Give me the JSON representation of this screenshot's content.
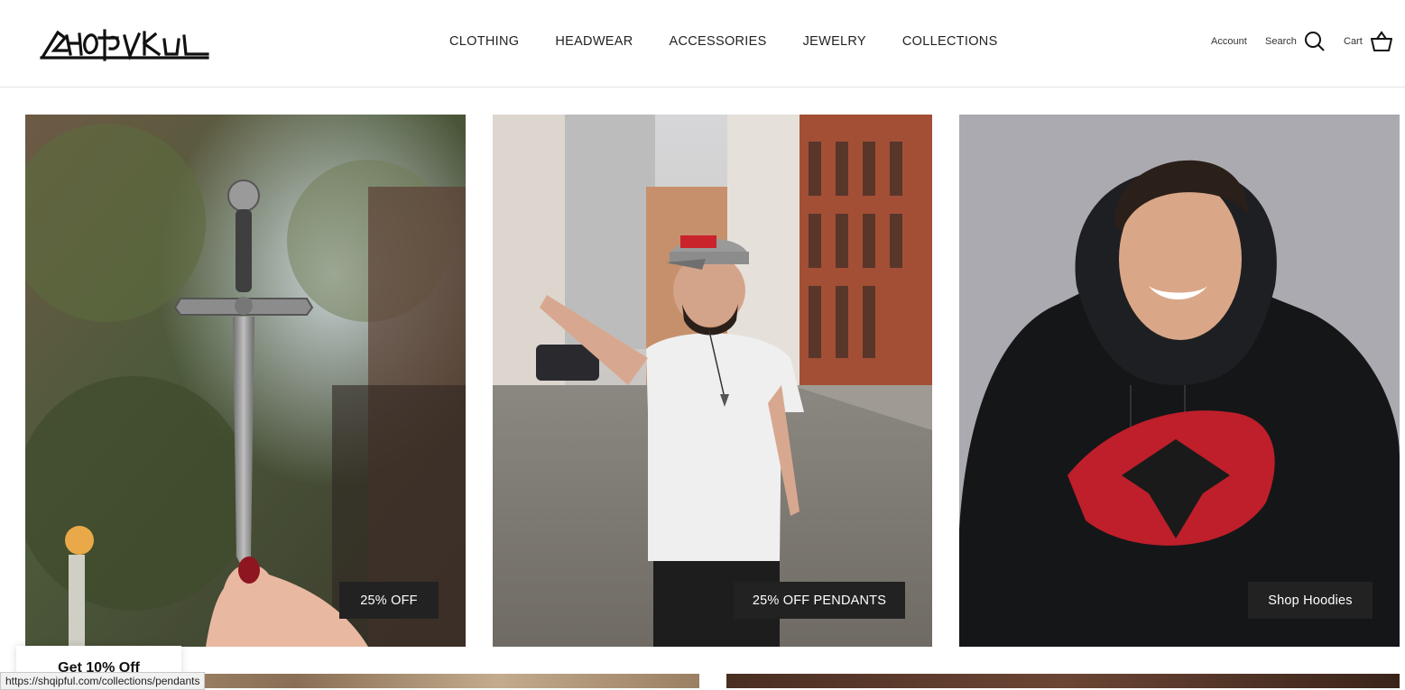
{
  "brand": {
    "logo_text": "SHQIPFUL"
  },
  "nav": {
    "items": [
      "CLOTHING",
      "HEADWEAR",
      "ACCESSORIES",
      "JEWELRY",
      "COLLECTIONS"
    ]
  },
  "utility": {
    "account": "Account",
    "search": "Search",
    "cart": "Cart"
  },
  "tiles": [
    {
      "cta": "25% OFF",
      "image": "sword-pendant-held-in-hand"
    },
    {
      "cta": "25% OFF PENDANTS",
      "image": "man-in-white-tee-on-street"
    },
    {
      "cta": "Shop Hoodies",
      "image": "man-in-black-eagle-hoodie"
    }
  ],
  "popup": {
    "label": "Get 10% Off"
  },
  "status_url": "https://shqipful.com/collections/pendants"
}
